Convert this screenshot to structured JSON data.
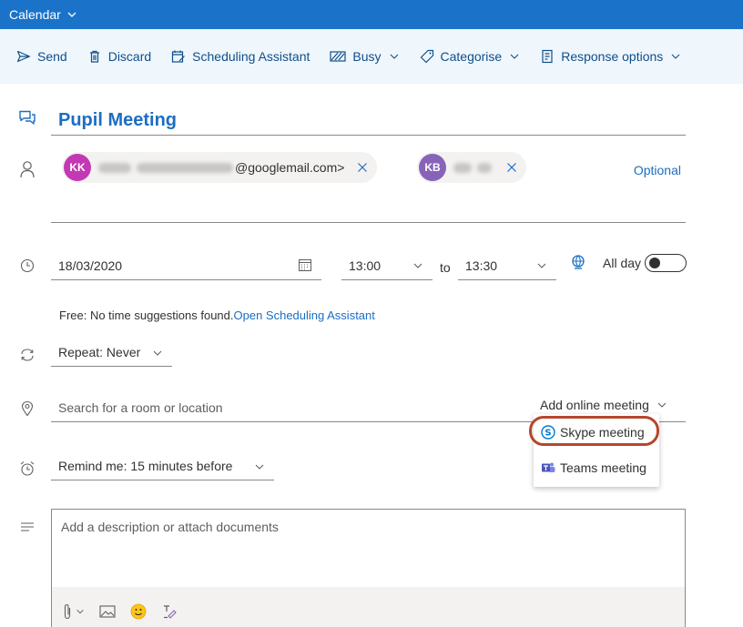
{
  "titlebar": {
    "title": "Calendar"
  },
  "toolbar": {
    "send": "Send",
    "discard": "Discard",
    "scheduling": "Scheduling Assistant",
    "busy": "Busy",
    "categorise": "Categorise",
    "response": "Response options"
  },
  "event": {
    "title": "Pupil Meeting"
  },
  "attendees": [
    {
      "initials": "KK",
      "email_suffix": "@googlemail.com>",
      "color": "#c239b3"
    },
    {
      "initials": "KB",
      "color": "#8764b8"
    }
  ],
  "optional_label": "Optional",
  "date": "18/03/2020",
  "start_time": "13:00",
  "to_label": "to",
  "end_time": "13:30",
  "all_day_label": "All day",
  "free": {
    "prefix": "Free:  No time suggestions found.",
    "link": "Open Scheduling Assistant"
  },
  "repeat": "Repeat: Never",
  "location_placeholder": "Search for a room or location",
  "online_meeting_label": "Add online meeting",
  "online_menu": [
    "Skype meeting",
    "Teams meeting"
  ],
  "reminder": "Remind me: 15 minutes before",
  "description_placeholder": "Add a description or attach documents",
  "colors": {
    "accent": "#1b6ec2",
    "titlebar": "#1a73c9",
    "toolbar_bg": "#eff6fc",
    "highlight": "#b5462c"
  }
}
